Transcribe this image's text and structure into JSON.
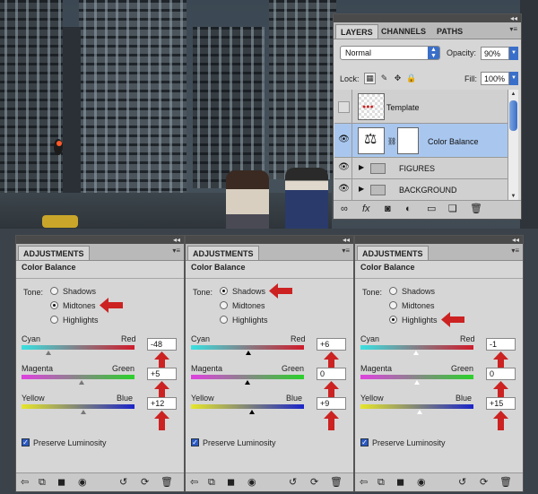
{
  "colors": {
    "arrow": "#cc2222",
    "selected_layer": "#a9c7ee",
    "blend_accent": "#3a6fc9"
  },
  "layers_panel": {
    "tabs": [
      "LAYERS",
      "CHANNELS",
      "PATHS"
    ],
    "blend_mode": "Normal",
    "opacity_label": "Opacity:",
    "opacity_value": "90%",
    "lock_label": "Lock:",
    "fill_label": "Fill:",
    "fill_value": "100%",
    "layers": [
      {
        "name": "Template",
        "visible": false,
        "selected": false
      },
      {
        "name": "Color Balance",
        "visible": true,
        "selected": true
      },
      {
        "name": "FIGURES",
        "visible": true,
        "selected": false
      },
      {
        "name": "BACKGROUND",
        "visible": true,
        "selected": false
      }
    ]
  },
  "adjustments": [
    {
      "tab": "ADJUSTMENTS",
      "title": "Color Balance",
      "tone_label": "Tone:",
      "tones": [
        "Shadows",
        "Midtones",
        "Highlights"
      ],
      "selected_tone": "Midtones",
      "sliders": [
        {
          "left": "Cyan",
          "right": "Red",
          "value": "-48"
        },
        {
          "left": "Magenta",
          "right": "Green",
          "value": "+5"
        },
        {
          "left": "Yellow",
          "right": "Blue",
          "value": "+12"
        }
      ],
      "preserve_label": "Preserve Luminosity"
    },
    {
      "tab": "ADJUSTMENTS",
      "title": "Color Balance",
      "tone_label": "Tone:",
      "tones": [
        "Shadows",
        "Midtones",
        "Highlights"
      ],
      "selected_tone": "Shadows",
      "sliders": [
        {
          "left": "Cyan",
          "right": "Red",
          "value": "+6"
        },
        {
          "left": "Magenta",
          "right": "Green",
          "value": "0"
        },
        {
          "left": "Yellow",
          "right": "Blue",
          "value": "+9"
        }
      ],
      "preserve_label": "Preserve Luminosity"
    },
    {
      "tab": "ADJUSTMENTS",
      "title": "Color Balance",
      "tone_label": "Tone:",
      "tones": [
        "Shadows",
        "Midtones",
        "Highlights"
      ],
      "selected_tone": "Highlights",
      "sliders": [
        {
          "left": "Cyan",
          "right": "Red",
          "value": "-1"
        },
        {
          "left": "Magenta",
          "right": "Green",
          "value": "0"
        },
        {
          "left": "Yellow",
          "right": "Blue",
          "value": "+15"
        }
      ],
      "preserve_label": "Preserve Luminosity"
    }
  ]
}
